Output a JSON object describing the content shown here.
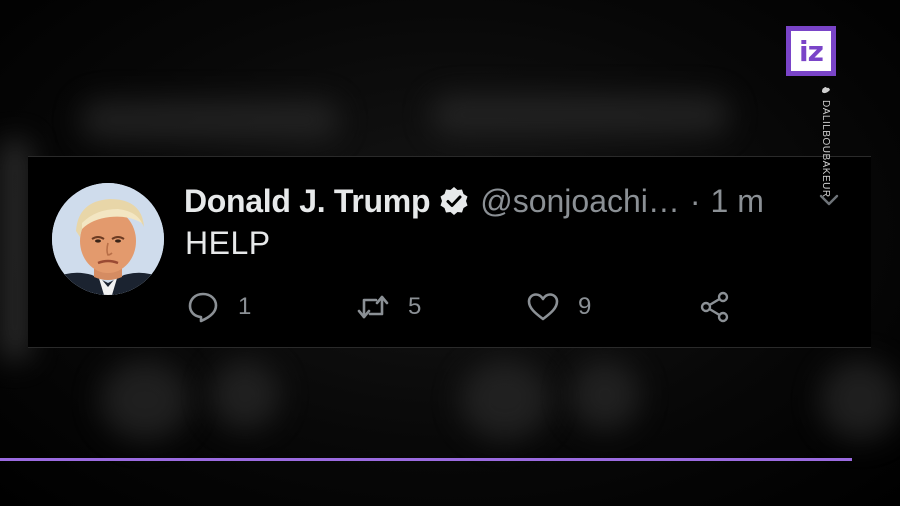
{
  "tweet": {
    "display_name": "Donald J. Trump",
    "handle": "@sonjoachi…",
    "separator": "·",
    "time": "1 m",
    "text": "HELP",
    "reply_count": "1",
    "retweet_count": "5",
    "like_count": "9",
    "verified_color": "#e7e9ea"
  },
  "overlay": {
    "logo_text": "iz",
    "credit": "DALILBOUBAKEUR",
    "logo_color": "#7a44c8",
    "accent_color": "#9b6be0"
  }
}
